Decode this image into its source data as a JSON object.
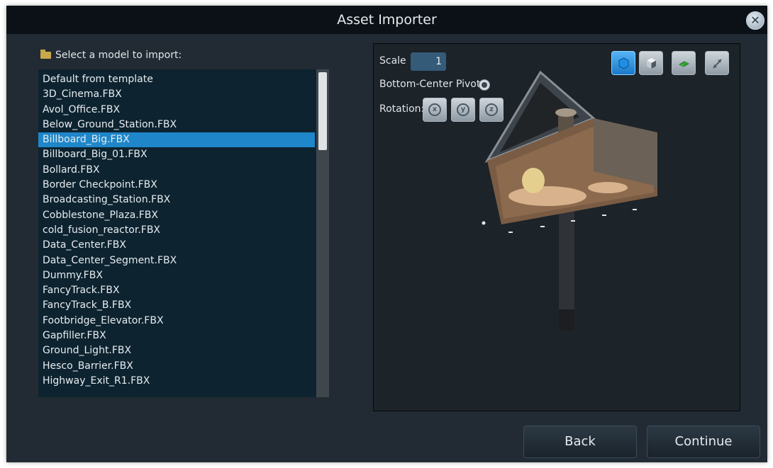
{
  "window": {
    "title": "Asset Importer",
    "close_glyph": "✕"
  },
  "list": {
    "label": "Select a model to import:",
    "selected_index": 4,
    "items": [
      "Default from template",
      "3D_Cinema.FBX",
      "Avol_Office.FBX",
      "Below_Ground_Station.FBX",
      "Billboard_Big.FBX",
      "Billboard_Big_01.FBX",
      "Bollard.FBX",
      "Border Checkpoint.FBX",
      "Broadcasting_Station.FBX",
      "Cobblestone_Plaza.FBX",
      "cold_fusion_reactor.FBX",
      "Data_Center.FBX",
      "Data_Center_Segment.FBX",
      "Dummy.FBX",
      "FancyTrack.FBX",
      "FancyTrack_B.FBX",
      "Footbridge_Elevator.FBX",
      "Gapfiller.FBX",
      "Ground_Light.FBX",
      "Hesco_Barrier.FBX",
      "Highway_Exit_R1.FBX"
    ]
  },
  "preview": {
    "scale_label": "Scale",
    "scale_value": "1",
    "pivot_label": "Bottom-Center Pivot",
    "rotation_label": "Rotation:",
    "rotation_buttons": [
      "rotate-x-icon",
      "rotate-y-icon",
      "rotate-z-icon"
    ],
    "tools": [
      "solid-view-icon",
      "shaded-cube-icon",
      "ground-grid-icon",
      "fit-view-icon"
    ]
  },
  "buttons": {
    "back": "Back",
    "continue": "Continue"
  },
  "colors": {
    "accent": "#1e86c9",
    "background": "#222b33",
    "titlebar": "#0c1117"
  }
}
